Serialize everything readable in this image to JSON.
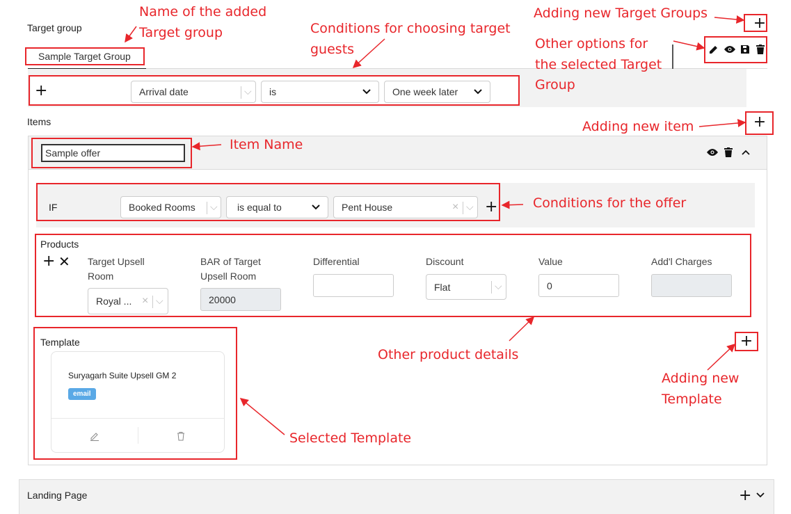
{
  "target_group": {
    "heading": "Target group",
    "tab_name": "Sample Target Group",
    "add_symbol": "+",
    "condition": {
      "field": "Arrival date",
      "operator": "is",
      "value": "One week later"
    }
  },
  "items": {
    "heading": "Items",
    "add_symbol": "+",
    "item": {
      "name_value": "Sample offer",
      "if_label": "IF",
      "condition": {
        "field": "Booked Rooms",
        "operator": "is equal to",
        "value": "Pent House"
      },
      "products": {
        "heading": "Products",
        "columns": {
          "target_room": "Target Upsell Room",
          "bar": "BAR of Target Upsell Room",
          "differential": "Differential",
          "discount": "Discount",
          "value": "Value",
          "addl": "Add'l Charges"
        },
        "row": {
          "target_room": "Royal ...",
          "bar": "20000",
          "differential": "",
          "discount": "Flat",
          "value": "0",
          "addl": ""
        }
      },
      "template": {
        "heading": "Template",
        "card_title": "Suryagarh Suite Upsell GM 2",
        "badge": "email"
      }
    }
  },
  "landing_page": {
    "heading": "Landing Page"
  },
  "annotations": {
    "name_added_1": "Name of the added",
    "name_added_2": "Target group",
    "conditions_guests_1": "Conditions for choosing target",
    "conditions_guests_2": "guests",
    "adding_groups": "Adding new Target Groups",
    "other_options_1": "Other options for",
    "other_options_2": "the selected Target",
    "other_options_3": "Group",
    "adding_item": "Adding new item",
    "item_name": "Item Name",
    "conditions_offer": "Conditions for the offer",
    "other_product": "Other product details",
    "adding_template_1": "Adding new",
    "adding_template_2": "Template",
    "selected_template": "Selected Template"
  },
  "colors": {
    "annotation": "#e8262b",
    "badge": "#5aa9e6"
  }
}
